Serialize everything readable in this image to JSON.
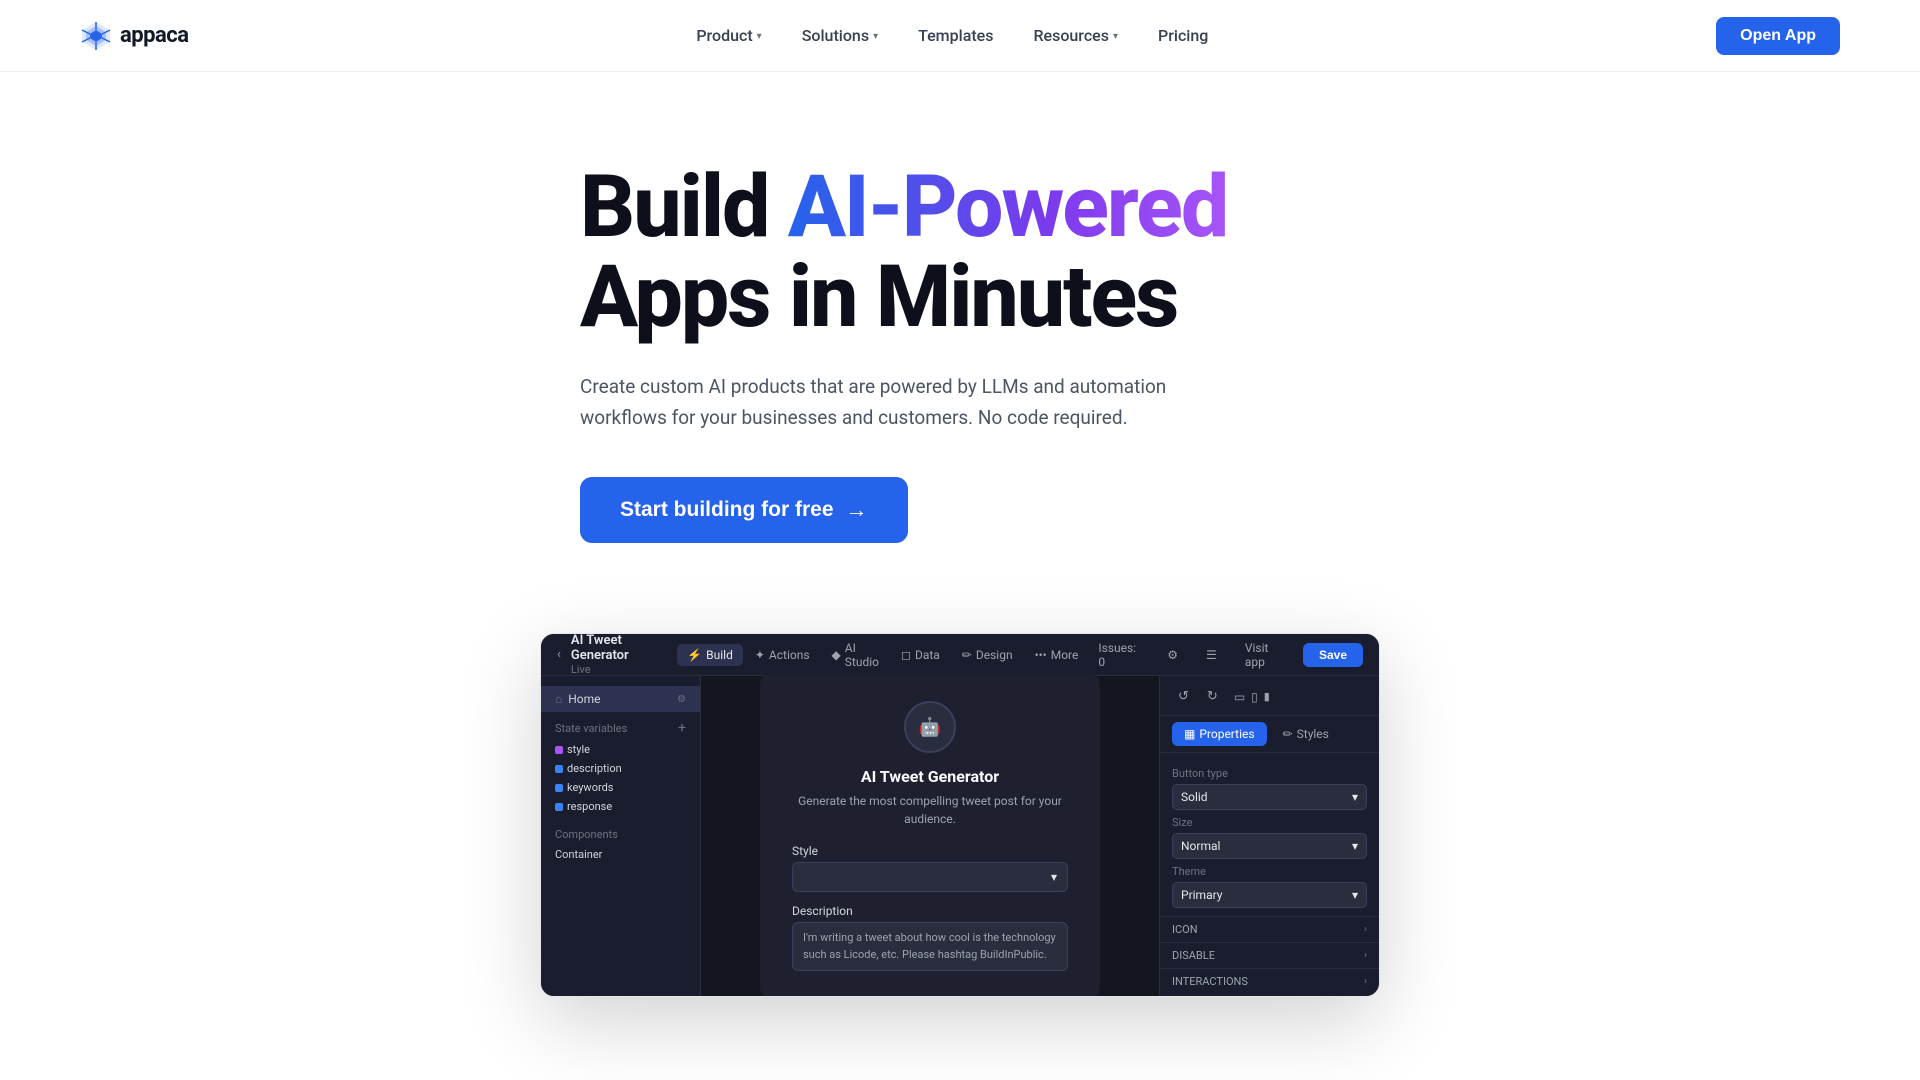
{
  "brand": {
    "name": "appaca",
    "logo_icon": "✦"
  },
  "nav": {
    "links": [
      {
        "label": "Product",
        "has_dropdown": true
      },
      {
        "label": "Solutions",
        "has_dropdown": true
      },
      {
        "label": "Templates",
        "has_dropdown": false
      },
      {
        "label": "Resources",
        "has_dropdown": true
      },
      {
        "label": "Pricing",
        "has_dropdown": false
      }
    ],
    "cta_label": "Open App"
  },
  "hero": {
    "heading_plain": "Build ",
    "heading_gradient": "AI-Powered",
    "heading_rest": "Apps in Minutes",
    "subheading": "Create custom AI products that are powered by LLMs and automation workflows for your businesses and customers. No code required.",
    "cta_label": "Start building for free",
    "cta_arrow": "→"
  },
  "app_window": {
    "title": "AI Tweet Generator",
    "subtitle": "Live",
    "topbar_nav": [
      {
        "label": "Build",
        "icon": "⚡",
        "active": true
      },
      {
        "label": "Actions",
        "icon": "✦",
        "active": false
      },
      {
        "label": "AI Studio",
        "icon": "◆",
        "active": false
      },
      {
        "label": "Data",
        "icon": "◻",
        "active": false
      },
      {
        "label": "Design",
        "icon": "✏",
        "active": false
      },
      {
        "label": "More",
        "icon": "•••",
        "active": false
      }
    ],
    "topbar_right": [
      {
        "label": "Issues: 0"
      },
      {
        "label": "⚙"
      },
      {
        "label": "☰"
      },
      {
        "label": "Visit app"
      }
    ],
    "save_label": "Save",
    "sidebar": {
      "home_item": "Home",
      "state_vars_label": "State variables",
      "state_vars": [
        {
          "name": "style",
          "color": "#a855f7"
        },
        {
          "name": "description",
          "color": "#3b82f6"
        },
        {
          "name": "keywords",
          "color": "#3b82f6"
        },
        {
          "name": "response",
          "color": "#3b82f6"
        }
      ],
      "components_label": "Components",
      "component_items": [
        "Container"
      ]
    },
    "preview": {
      "title": "AI Tweet Generator",
      "description": "Generate the most compelling tweet post for your audience.",
      "style_label": "Style",
      "style_placeholder": "",
      "description_label": "Description",
      "description_placeholder": "I'm writing a tweet about how cool is the technology such as Licode, etc. Please hashtag BuildInPublic."
    },
    "right_panel": {
      "properties_tab": "Properties",
      "styles_tab": "Styles",
      "button_type_label": "Button type",
      "button_type_value": "Solid",
      "size_label": "Size",
      "size_value": "Normal",
      "theme_label": "Theme",
      "theme_value": "Primary",
      "icon_label": "ICON",
      "disable_label": "DISABLE",
      "interactions_label": "INTERACTIONS"
    }
  }
}
